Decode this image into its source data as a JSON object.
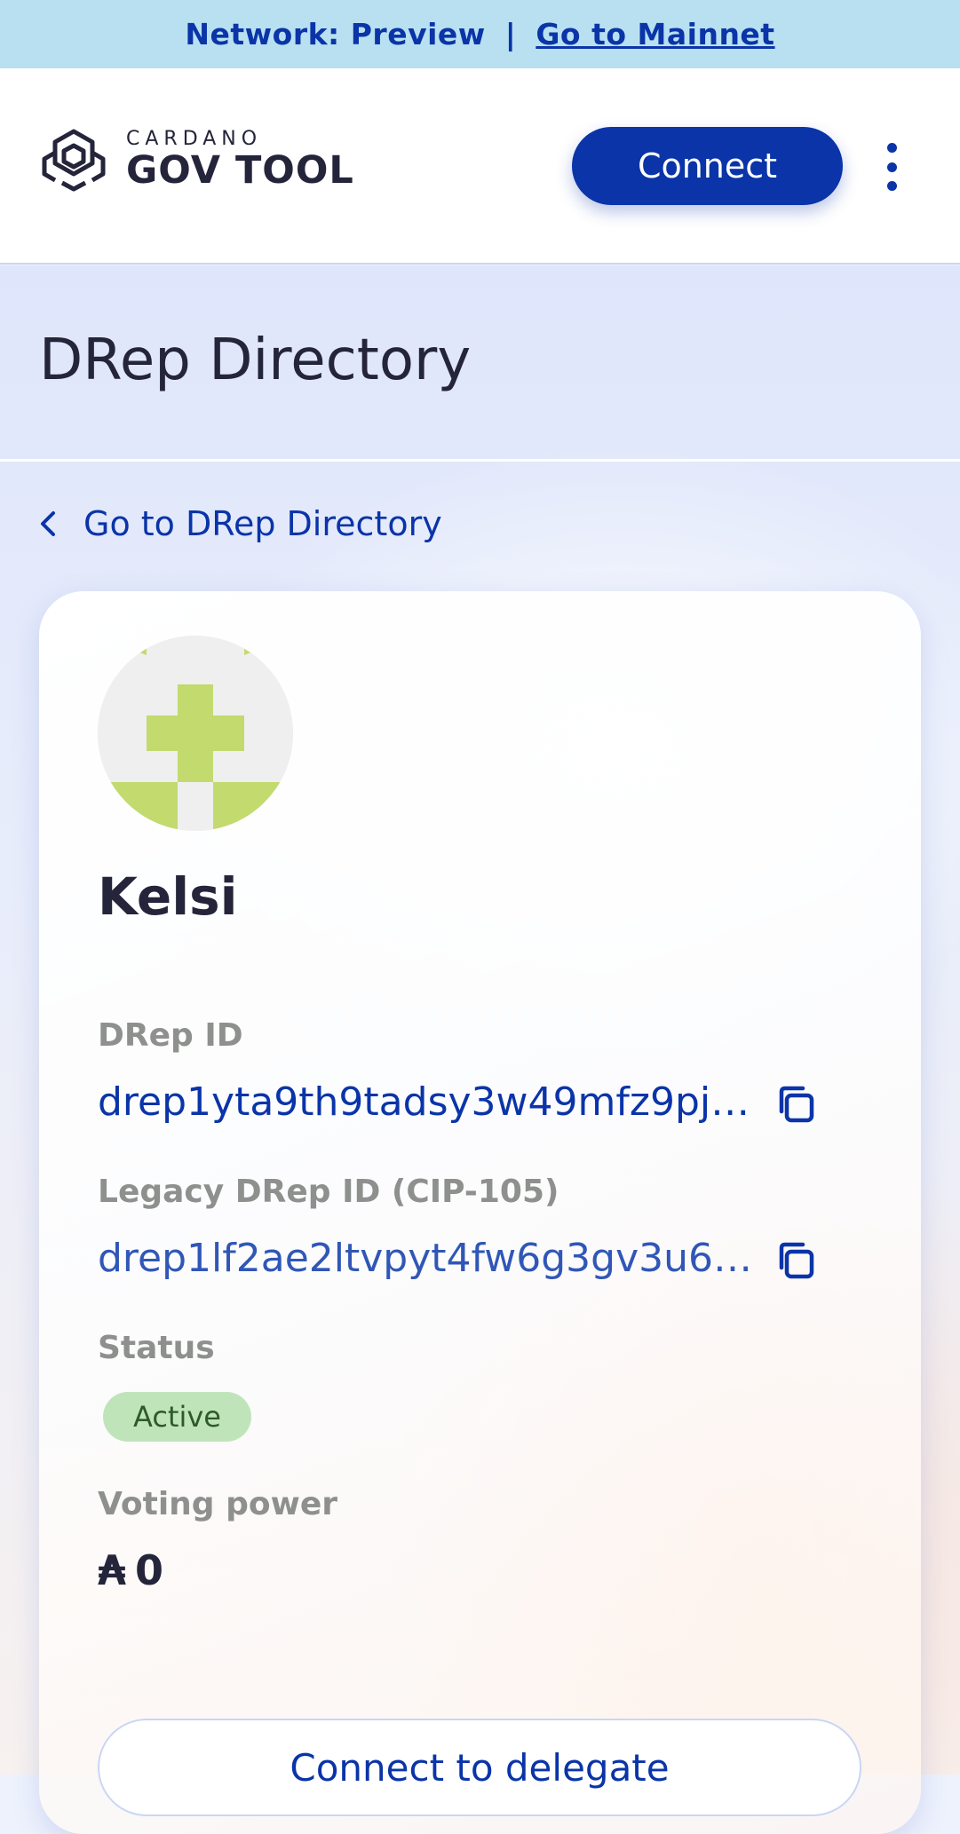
{
  "network_banner": {
    "network_text": "Network: Preview",
    "separator": "|",
    "mainnet_link": "Go to Mainnet"
  },
  "header": {
    "logo_small": "CARDANO",
    "logo_big": "GOV TOOL",
    "connect_label": "Connect"
  },
  "page": {
    "title": "DRep Directory",
    "back_link": "Go to DRep Directory"
  },
  "drep": {
    "name": "Kelsi",
    "drep_id_label": "DRep ID",
    "drep_id": "drep1yta9th9tadsy3w49mfz9pj…",
    "legacy_id_label": "Legacy DRep ID (CIP-105)",
    "legacy_id": "drep1lf2ae2ltvpyt4fw6g3gv3u6r…",
    "status_label": "Status",
    "status": "Active",
    "voting_power_label": "Voting power",
    "voting_power_symbol": "₳",
    "voting_power": "0",
    "delegate_button": "Connect to delegate"
  },
  "colors": {
    "primary": "#0a34a8",
    "banner_bg": "#b8e0f0",
    "status_bg": "#c0e4ba",
    "avatar_green": "#c2da6e"
  },
  "icons": {
    "logo": "hexagon-logo-icon",
    "menu": "vertical-dots-icon",
    "back": "chevron-left-icon",
    "copy": "copy-icon"
  }
}
